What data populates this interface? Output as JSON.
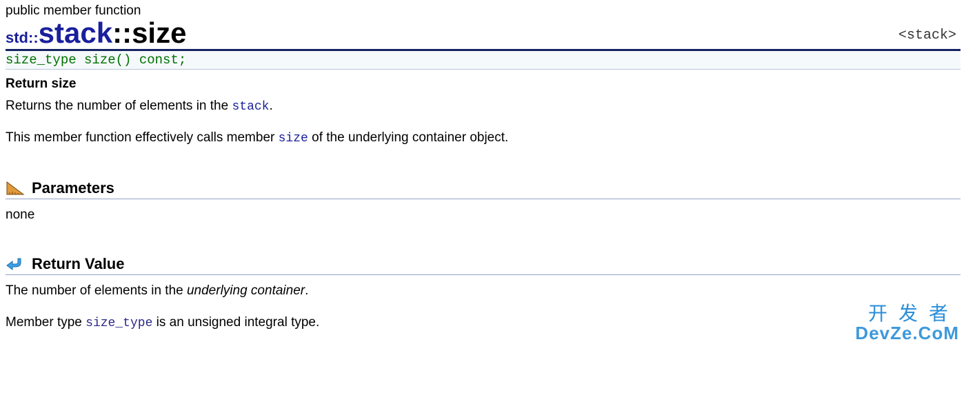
{
  "category": "public member function",
  "header_tag": "<stack>",
  "title": {
    "ns": "std::",
    "class": "stack",
    "sep": "::",
    "member": "size"
  },
  "signature": "size_type size() const;",
  "brief": "Return size",
  "desc1_a": "Returns the number of elements in the ",
  "desc1_code": "stack",
  "desc1_b": ".",
  "desc2_a": "This member function effectively calls member ",
  "desc2_code": "size",
  "desc2_b": " of the underlying container object.",
  "sections": {
    "parameters": {
      "heading": "Parameters",
      "body": "none"
    },
    "return_value": {
      "heading": "Return Value",
      "line1_a": "The number of elements in the ",
      "line1_i": "underlying container",
      "line1_b": ".",
      "line2_a": "Member type ",
      "line2_code": "size_type",
      "line2_b": " is an unsigned integral type."
    }
  },
  "watermark": {
    "line1": "开发者",
    "line2": "DevZe.CoM"
  }
}
